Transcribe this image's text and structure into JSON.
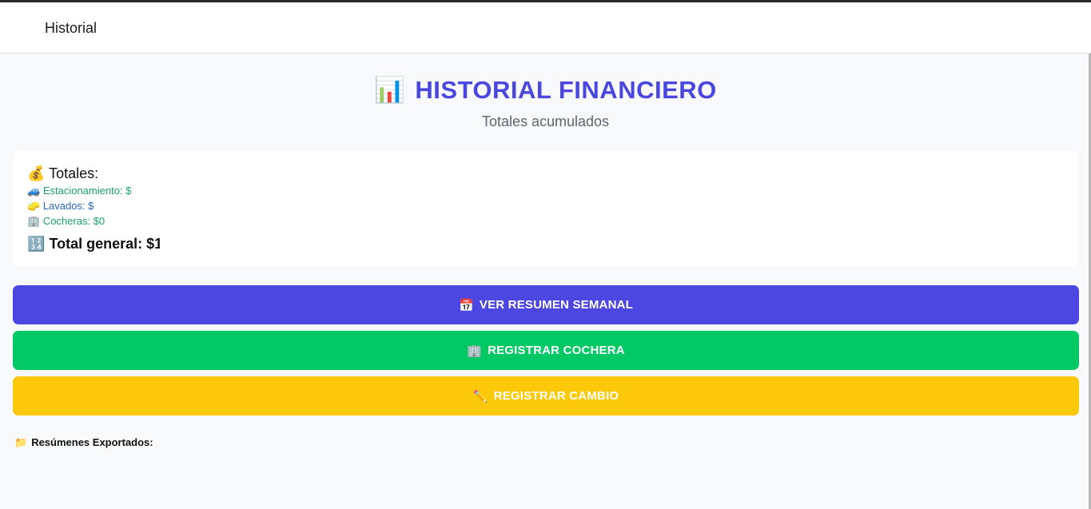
{
  "header": {
    "title": "Historial"
  },
  "page": {
    "title_icon": "📊",
    "title": "HISTORIAL FINANCIERO",
    "subtitle": "Totales acumulados"
  },
  "totals": {
    "heading_icon": "💰",
    "heading": "Totales:",
    "items": [
      {
        "icon": "🚙",
        "label": "Estacionamiento: $"
      },
      {
        "icon": "🧽",
        "label": "Lavados: $"
      },
      {
        "icon": "🏢",
        "label": "Cocheras: $0"
      }
    ],
    "grand_icon": "🔢",
    "grand_label": "Total general: $1"
  },
  "buttons": {
    "weekly": {
      "icon": "📅",
      "label": "VER RESUMEN SEMANAL"
    },
    "garage": {
      "icon": "🏢",
      "label": "REGISTRAR COCHERA"
    },
    "change": {
      "icon": "✏️",
      "label": "REGISTRAR CAMBIO"
    }
  },
  "exports": {
    "icon": "📁",
    "label": "Resúmenes Exportados:"
  },
  "colors": {
    "accent": "#4a46de",
    "green": "#00c864",
    "yellow": "#fcc90a",
    "blue_button": "#4c47e0"
  }
}
